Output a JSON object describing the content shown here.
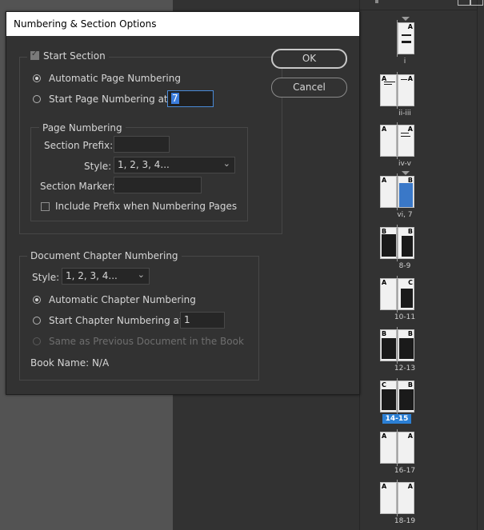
{
  "dialog": {
    "title": "Numbering & Section Options",
    "ok_label": "OK",
    "cancel_label": "Cancel",
    "start_section": {
      "label": "Start Section",
      "checked": true
    },
    "automatic_page_numbering": {
      "label": "Automatic Page Numbering",
      "selected": true
    },
    "start_page_numbering": {
      "label": "Start Page Numbering at:",
      "value": "7",
      "selected": false
    },
    "page_numbering": {
      "legend": "Page Numbering",
      "section_prefix_label": "Section Prefix:",
      "section_prefix_value": "",
      "style_label": "Style:",
      "style_value": "1, 2, 3, 4...",
      "section_marker_label": "Section Marker:",
      "section_marker_value": "",
      "include_prefix_label": "Include Prefix when Numbering Pages"
    },
    "document_chapter_numbering": {
      "legend": "Document Chapter Numbering",
      "style_label": "Style:",
      "style_value": "1, 2, 3, 4...",
      "automatic_label": "Automatic Chapter Numbering",
      "start_label": "Start Chapter Numbering at:",
      "start_value": "1",
      "same_as_previous_label": "Same as Previous Document in the Book",
      "book_name": "Book Name: N/A"
    }
  },
  "pages_panel": {
    "spreads": [
      {
        "label": "i",
        "masters": [
          "A"
        ]
      },
      {
        "label": "ii-iii",
        "masters": [
          "A",
          "A"
        ]
      },
      {
        "label": "iv-v",
        "masters": [
          "A",
          "A"
        ]
      },
      {
        "label": "vi, 7",
        "masters": [
          "A",
          "B"
        ]
      },
      {
        "label": "8-9",
        "masters": [
          "B",
          "B"
        ]
      },
      {
        "label": "10-11",
        "masters": [
          "A",
          "C"
        ]
      },
      {
        "label": "12-13",
        "masters": [
          "B",
          "B"
        ]
      },
      {
        "label": "14-15",
        "masters": [
          "C",
          "B"
        ],
        "selected": true
      },
      {
        "label": "16-17",
        "masters": [
          "A",
          "A"
        ]
      },
      {
        "label": "18-19",
        "masters": [
          "A",
          "A"
        ]
      }
    ]
  }
}
